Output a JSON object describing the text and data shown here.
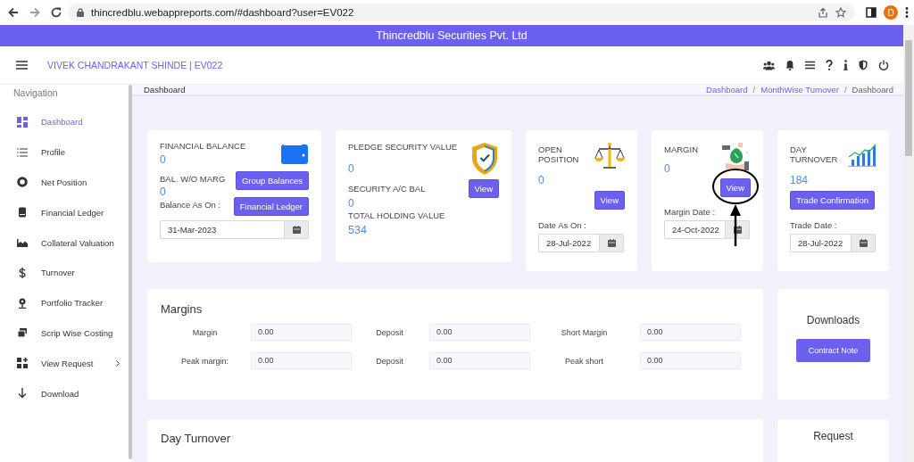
{
  "browser": {
    "url": "thincredblu.webappreports.com/#dashboard?user=EV022",
    "profile_initial": "D"
  },
  "app_title": "Thincredblu Securities Pvt. Ltd",
  "header": {
    "user": "VIVEK CHANDRAKANT SHINDE | EV022"
  },
  "sidebar": {
    "heading": "Navigation",
    "items": [
      {
        "label": "Dashboard",
        "selected": true,
        "has_submenu": false
      },
      {
        "label": "Profile",
        "selected": false,
        "has_submenu": false
      },
      {
        "label": "Net Position",
        "selected": false,
        "has_submenu": false
      },
      {
        "label": "Financial Ledger",
        "selected": false,
        "has_submenu": false
      },
      {
        "label": "Collateral Valuation",
        "selected": false,
        "has_submenu": false
      },
      {
        "label": "Turnover",
        "selected": false,
        "has_submenu": false
      },
      {
        "label": "Portfolio Tracker",
        "selected": false,
        "has_submenu": false
      },
      {
        "label": "Scrip Wise Costing",
        "selected": false,
        "has_submenu": false
      },
      {
        "label": "View Request",
        "selected": false,
        "has_submenu": true
      },
      {
        "label": "Download",
        "selected": false,
        "has_submenu": false
      }
    ]
  },
  "breadcrumb": {
    "page": "Dashboard",
    "separators": [
      "/",
      "/"
    ],
    "trail": [
      {
        "label": "Dashboard",
        "current": false
      },
      {
        "label": "MonthWise Turnover",
        "current": false
      },
      {
        "label": "Dashboard",
        "current": true
      }
    ]
  },
  "cards": [
    {
      "kind": "balance",
      "title": "FINANCIAL BALANCE",
      "value": "0",
      "sub_label": "BAL. W/O MARG",
      "sub_value": "0",
      "date_label": "Balance As On :",
      "buttons": [
        {
          "label": "Group Balances",
          "highlighted": false
        },
        {
          "label": "Financial Ledger",
          "highlighted": false
        }
      ],
      "date": "31-Mar-2023"
    },
    {
      "kind": "pledge",
      "title": "PLEDGE SECURITY VALUE",
      "value": "0",
      "sub_label": "SECURITY A/C BAL",
      "sub_value": "0",
      "total_label": "TOTAL HOLDING VALUE",
      "total_value": "534",
      "buttons": [
        {
          "label": "View",
          "highlighted": false
        }
      ]
    },
    {
      "kind": "position",
      "title": "OPEN POSITION",
      "value": "0",
      "buttons": [
        {
          "label": "View",
          "highlighted": false
        }
      ],
      "date_label": "Date As On :",
      "date": "28-Jul-2022"
    },
    {
      "kind": "margin",
      "title": "MARGIN",
      "value": "0",
      "buttons": [
        {
          "label": "View",
          "highlighted": true
        }
      ],
      "date_label": "Margin Date :",
      "date": "24-Oct-2022"
    },
    {
      "kind": "turnover",
      "title": "DAY TURNOVER",
      "value": "184",
      "buttons": [
        {
          "label": "Trade Confirmation",
          "highlighted": false
        }
      ],
      "date_label": "Trade Date :",
      "date": "28-Jul-2022"
    }
  ],
  "margins": {
    "title": "Margins",
    "fields": [
      {
        "label": "Margin",
        "value": "0.00"
      },
      {
        "label": "Deposit",
        "value": "0.00"
      },
      {
        "label": "Short Margin",
        "value": "0.00"
      },
      {
        "label": "Peak margin:",
        "value": "0.00"
      },
      {
        "label": "Deposit",
        "value": "0.00"
      },
      {
        "label": "Peak short",
        "value": "0.00"
      }
    ]
  },
  "downloads": {
    "title": "Downloads",
    "button": "Contract Note"
  },
  "day_turnover": {
    "title": "Day Turnover"
  },
  "request": {
    "title": "Request"
  }
}
